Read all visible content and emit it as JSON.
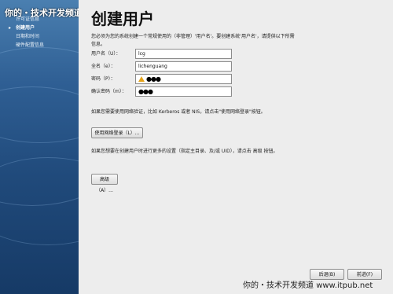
{
  "watermark": "你的・技术开发频道",
  "sidebar": {
    "items": [
      {
        "label": "许可证信息",
        "current": false
      },
      {
        "label": "创建用户",
        "current": true
      },
      {
        "label": "日期和时间",
        "current": false
      },
      {
        "label": "硬件配置信息",
        "current": false
      }
    ],
    "current_marker": "▸"
  },
  "page": {
    "title": "创建用户",
    "intro": "您必须为您的系统创建一个常规使用的（非管理）'用户名'。要创建系统'用户名'，请提供以下所需信息。"
  },
  "form": {
    "username": {
      "label": "用户名（U）：",
      "value": "lcg"
    },
    "fullname": {
      "label": "全名（e）：",
      "value": "lichenguang"
    },
    "password": {
      "label": "密码（P）：",
      "value": "●●●",
      "warning_icon": "warning-icon"
    },
    "confirm": {
      "label": "确认密码（m）：",
      "value": "●●●"
    }
  },
  "network": {
    "text": "如果您需要使用网络验证，比如 Kerberos 或者 NIS，请点击\"使用网络登录\"按钮。",
    "button": "使用网络登录（L）..."
  },
  "advanced": {
    "text": "如果您想要在创建用户时进行更多的设置（指定主目录、及/或 UID），请点击 高级 按钮。",
    "button": "高级（A）..."
  },
  "nav_buttons": {
    "back": "后退(B)",
    "forward": "前进(F)"
  },
  "footer": {
    "brand": "你的・技术开发频道",
    "url": "www.itpub.net"
  }
}
